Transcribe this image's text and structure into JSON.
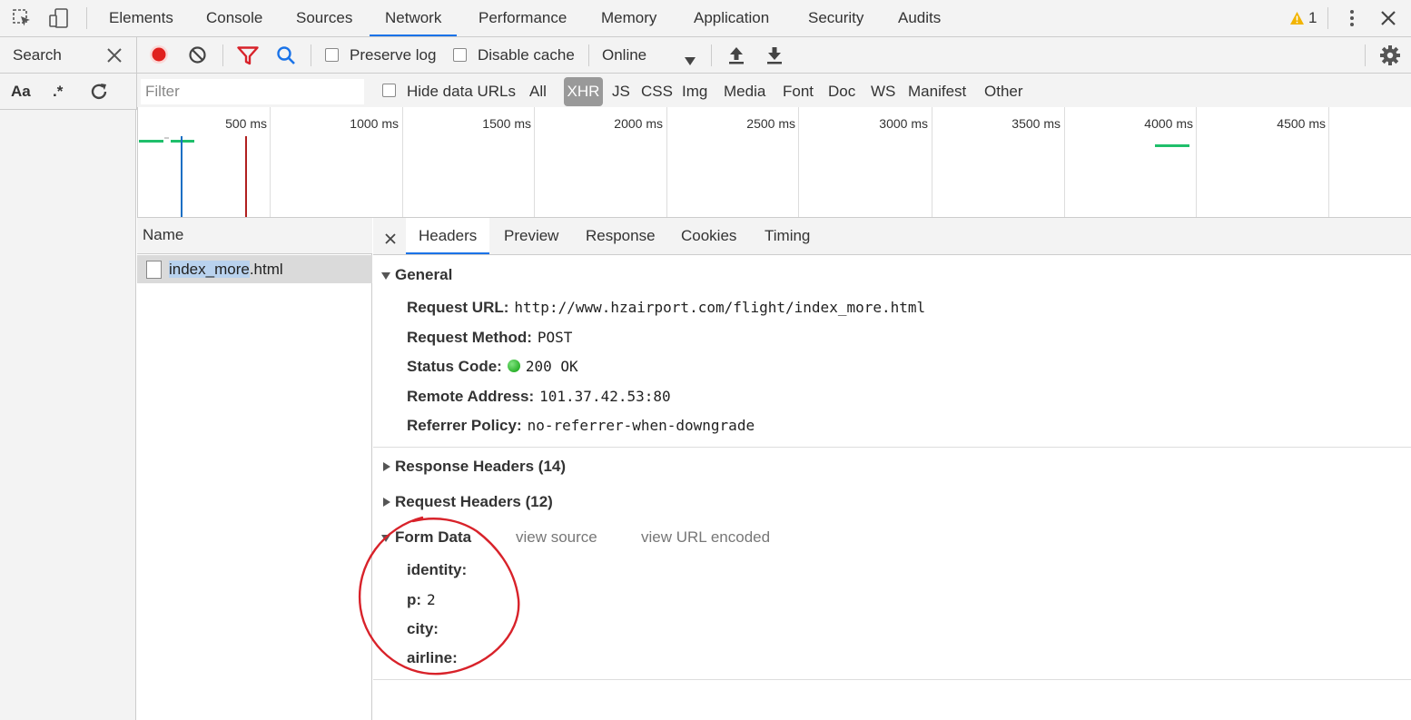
{
  "top_tabs": [
    {
      "label": "Elements"
    },
    {
      "label": "Console"
    },
    {
      "label": "Sources"
    },
    {
      "label": "Network"
    },
    {
      "label": "Performance"
    },
    {
      "label": "Memory"
    },
    {
      "label": "Application"
    },
    {
      "label": "Security"
    },
    {
      "label": "Audits"
    }
  ],
  "warnings": {
    "count": "1"
  },
  "search": {
    "label": "Search"
  },
  "toolbar": {
    "preserve_log": "Preserve log",
    "disable_cache": "Disable cache",
    "throttle": "Online"
  },
  "filterbar": {
    "case_label": "Aa",
    "regex_label": ".*",
    "filter_placeholder": "Filter",
    "hide_data_urls": "Hide data URLs",
    "types": [
      "All",
      "XHR",
      "JS",
      "CSS",
      "Img",
      "Media",
      "Font",
      "Doc",
      "WS",
      "Manifest",
      "Other"
    ],
    "selected_type": "XHR"
  },
  "overview": {
    "ticks": [
      "500 ms",
      "1000 ms",
      "1500 ms",
      "2000 ms",
      "2500 ms",
      "3000 ms",
      "3500 ms",
      "4000 ms",
      "4500 ms"
    ]
  },
  "requests": {
    "header": "Name",
    "items": [
      {
        "name_highlight": "index_more",
        "name_rest": ".html"
      }
    ]
  },
  "details": {
    "tabs": [
      "Headers",
      "Preview",
      "Response",
      "Cookies",
      "Timing"
    ],
    "active_tab": "Headers",
    "general": {
      "title": "General",
      "request_url_key": "Request URL:",
      "request_url": "http://www.hzairport.com/flight/index_more.html",
      "request_method_key": "Request Method:",
      "request_method": "POST",
      "status_code_key": "Status Code:",
      "status_code": "200 OK",
      "remote_address_key": "Remote Address:",
      "remote_address": "101.37.42.53:80",
      "referrer_policy_key": "Referrer Policy:",
      "referrer_policy": "no-referrer-when-downgrade"
    },
    "response_headers": "Response Headers (14)",
    "request_headers": "Request Headers (12)",
    "form_data": {
      "title": "Form Data",
      "view_source": "view source",
      "view_url_encoded": "view URL encoded",
      "fields": [
        {
          "key": "identity:",
          "value": ""
        },
        {
          "key": "p:",
          "value": "2"
        },
        {
          "key": "city:",
          "value": ""
        },
        {
          "key": "airline:",
          "value": ""
        }
      ]
    }
  },
  "colors": {
    "accent": "#1a73e8",
    "record": "#e0201d",
    "annotation": "#d8222a",
    "timeline_green": "#1fbf6b",
    "dom_line": "#1a6fc4",
    "load_line": "#b02020"
  }
}
